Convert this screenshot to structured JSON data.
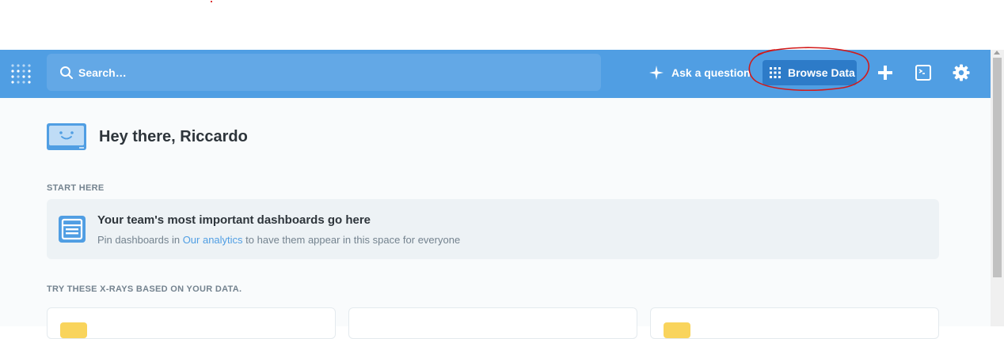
{
  "navbar": {
    "search_placeholder": "Search…",
    "ask_label": "Ask a question",
    "browse_label": "Browse Data",
    "icons": [
      "metabase-logo-icon",
      "search-icon",
      "sparkle-icon",
      "grid-icon",
      "plus-icon",
      "terminal-icon",
      "gear-icon"
    ]
  },
  "main": {
    "greeting": "Hey there, Riccardo",
    "start_here_label": "START HERE",
    "pin_title": "Your team's most important dashboards go here",
    "pin_sub_before": "Pin dashboards in ",
    "pin_sub_link": "Our analytics",
    "pin_sub_after": " to have them appear in this space for everyone",
    "xrays_label": "TRY THESE X-RAYS BASED ON YOUR DATA."
  },
  "colors": {
    "brand": "#509ee3",
    "browse_active": "#2d7bc8",
    "annotation": "#d11a1a",
    "chip_yellow": "#f9d45c"
  }
}
